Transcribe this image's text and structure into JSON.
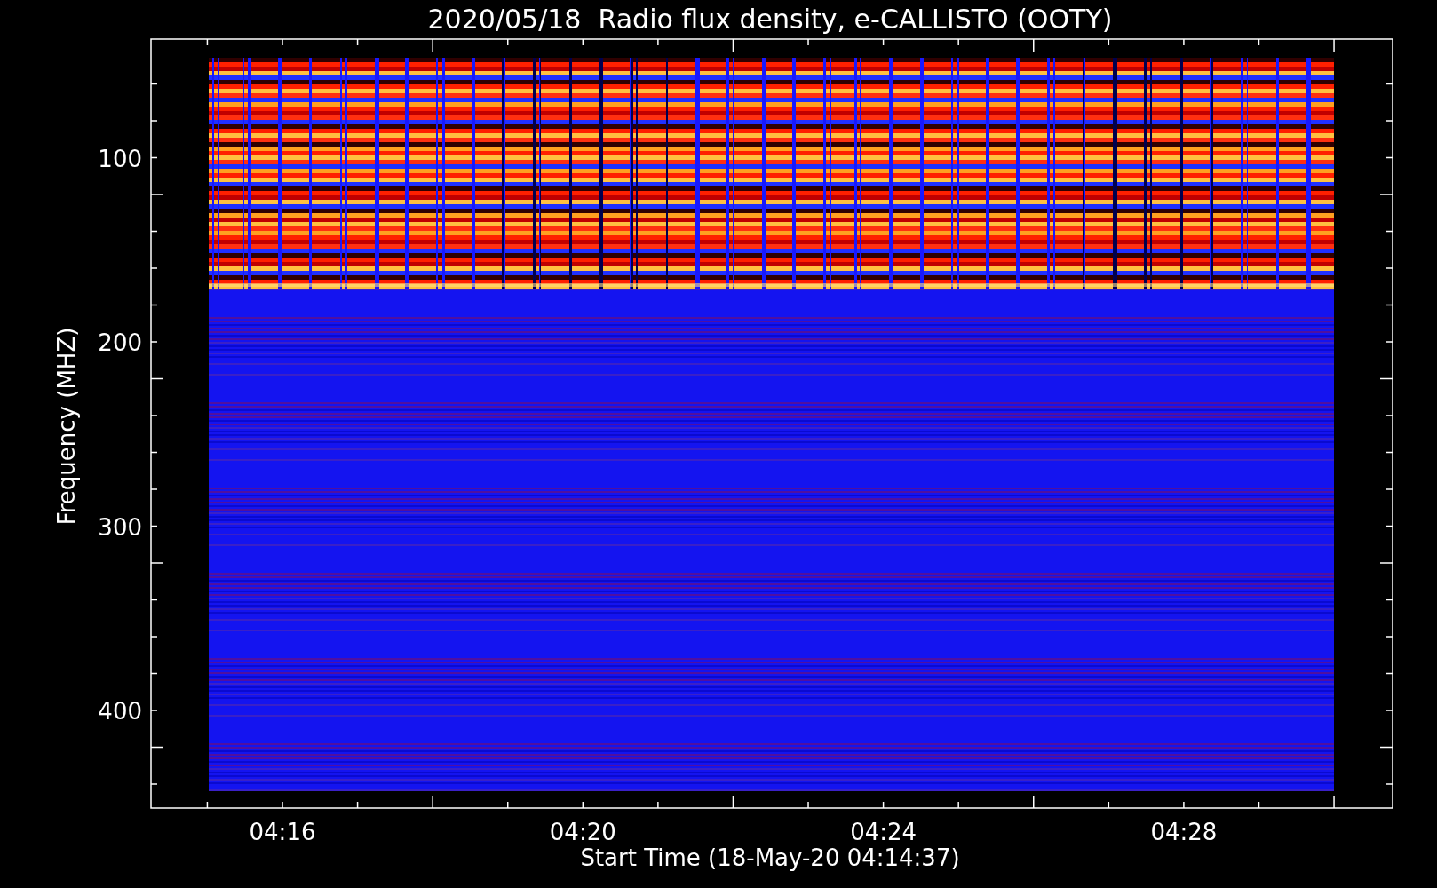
{
  "chart": {
    "title": "2020/05/18  Radio flux density, e-CALLISTO (OOTY)",
    "ylabel": "Frequency (MHZ)",
    "xlabel": "Start Time (18-May-20 04:14:37)",
    "yticks": [
      "100",
      "200",
      "300",
      "400"
    ],
    "xticks": [
      "04:16",
      "04:20",
      "04:24",
      "04:28"
    ]
  }
}
